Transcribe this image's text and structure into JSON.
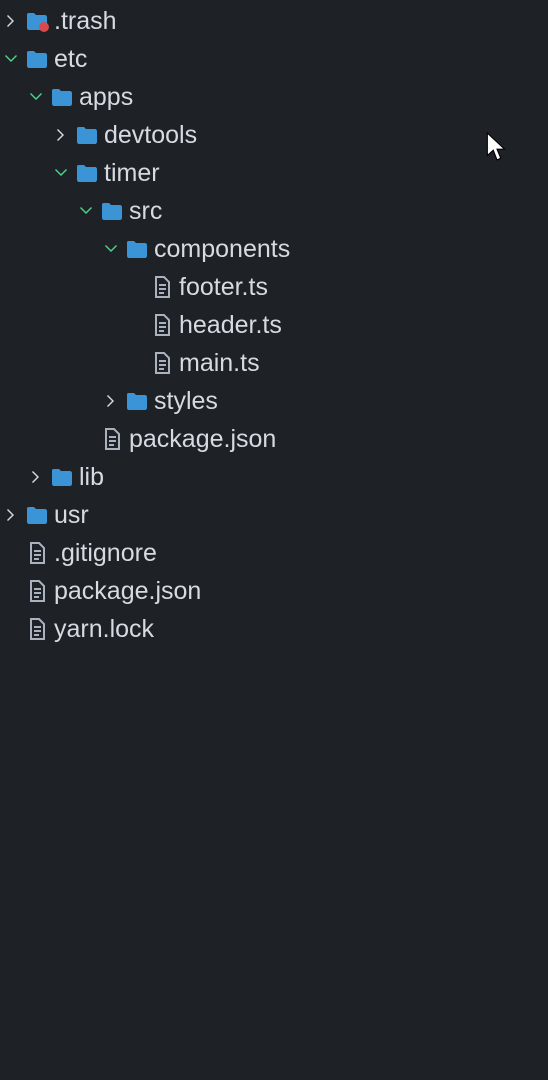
{
  "tree": [
    {
      "depth": 0,
      "kind": "folder",
      "name": ".trash",
      "expanded": false,
      "chevron": "closed",
      "trash": true,
      "id": "trash"
    },
    {
      "depth": 0,
      "kind": "folder",
      "name": "etc",
      "expanded": true,
      "chevron": "open",
      "id": "etc"
    },
    {
      "depth": 1,
      "kind": "folder",
      "name": "apps",
      "expanded": true,
      "chevron": "open",
      "id": "apps"
    },
    {
      "depth": 2,
      "kind": "folder",
      "name": "devtools",
      "expanded": false,
      "chevron": "closed",
      "id": "devtools"
    },
    {
      "depth": 2,
      "kind": "folder",
      "name": "timer",
      "expanded": true,
      "chevron": "open",
      "id": "timer"
    },
    {
      "depth": 3,
      "kind": "folder",
      "name": "src",
      "expanded": true,
      "chevron": "open",
      "id": "src"
    },
    {
      "depth": 4,
      "kind": "folder",
      "name": "components",
      "expanded": true,
      "chevron": "open",
      "id": "components"
    },
    {
      "depth": 5,
      "kind": "file",
      "name": "footer.ts",
      "id": "footer"
    },
    {
      "depth": 5,
      "kind": "file",
      "name": "header.ts",
      "id": "header"
    },
    {
      "depth": 5,
      "kind": "file",
      "name": "main.ts",
      "id": "main"
    },
    {
      "depth": 4,
      "kind": "folder",
      "name": "styles",
      "expanded": false,
      "chevron": "closed",
      "id": "styles"
    },
    {
      "depth": 3,
      "kind": "file",
      "name": "package.json",
      "id": "pkg-timer"
    },
    {
      "depth": 1,
      "kind": "folder",
      "name": "lib",
      "expanded": false,
      "chevron": "closed",
      "id": "lib"
    },
    {
      "depth": 0,
      "kind": "folder",
      "name": "usr",
      "expanded": false,
      "chevron": "closed",
      "id": "usr"
    },
    {
      "depth": 0,
      "kind": "file",
      "name": ".gitignore",
      "id": "gitignore"
    },
    {
      "depth": 0,
      "kind": "file",
      "name": "package.json",
      "id": "pkg-root"
    },
    {
      "depth": 0,
      "kind": "file",
      "name": "yarn.lock",
      "id": "yarnlock"
    }
  ]
}
